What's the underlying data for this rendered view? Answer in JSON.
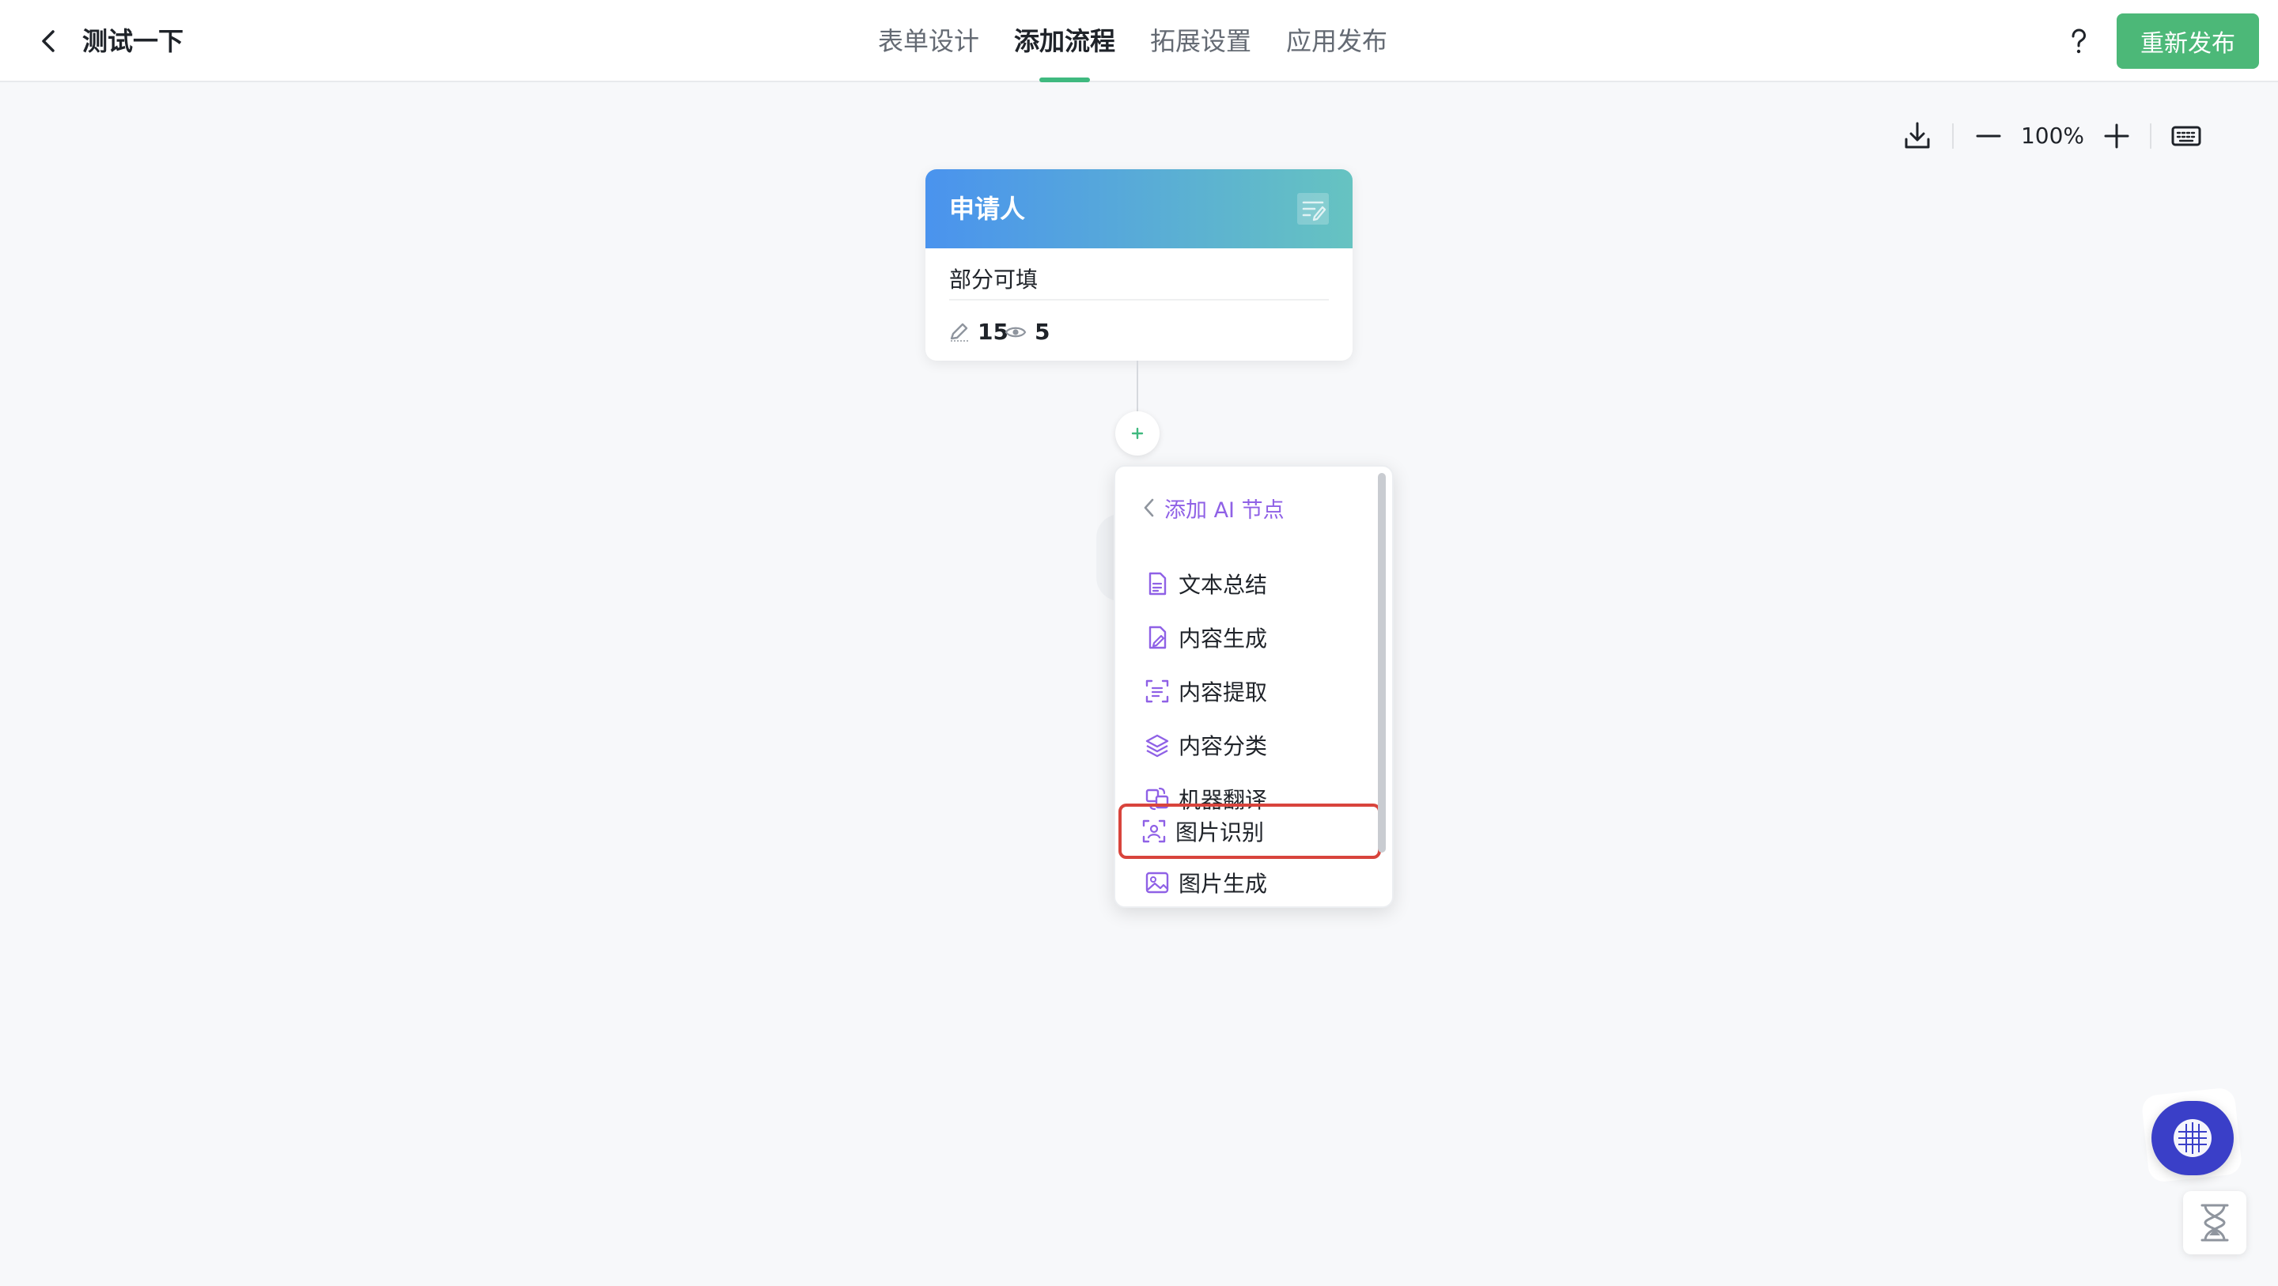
{
  "header": {
    "title": "测试一下",
    "tabs": [
      {
        "label": "表单设计",
        "active": false
      },
      {
        "label": "添加流程",
        "active": true
      },
      {
        "label": "拓展设置",
        "active": false
      },
      {
        "label": "应用发布",
        "active": false
      }
    ],
    "help_label": "?",
    "publish_label": "重新发布"
  },
  "toolbar": {
    "zoom": "100%",
    "icons": [
      "download-icon",
      "zoom-out-icon",
      "zoom-in-icon",
      "keyboard-icon"
    ]
  },
  "node": {
    "title": "申请人",
    "subtitle": "部分可填",
    "edit_count": "15",
    "view_count": "5"
  },
  "ai_menu": {
    "back_label": "添加 AI 节点",
    "items": [
      {
        "label": "文本总结",
        "icon": "text-summary-icon"
      },
      {
        "label": "内容生成",
        "icon": "content-generate-icon"
      },
      {
        "label": "内容提取",
        "icon": "content-extract-icon"
      },
      {
        "label": "内容分类",
        "icon": "layers-icon"
      },
      {
        "label": "机器翻译",
        "icon": "translate-icon"
      },
      {
        "label": "图片识别",
        "icon": "image-recognize-icon"
      },
      {
        "label": "图片生成",
        "icon": "image-generate-icon"
      }
    ]
  },
  "colors": {
    "accent_green": "#4cb878",
    "menu_purple": "#8f61e6",
    "highlight_red": "#d8443c",
    "node_header_start": "#4a93ee",
    "node_header_end": "#66c3c1",
    "assistant_blue": "#3a3fc8"
  }
}
